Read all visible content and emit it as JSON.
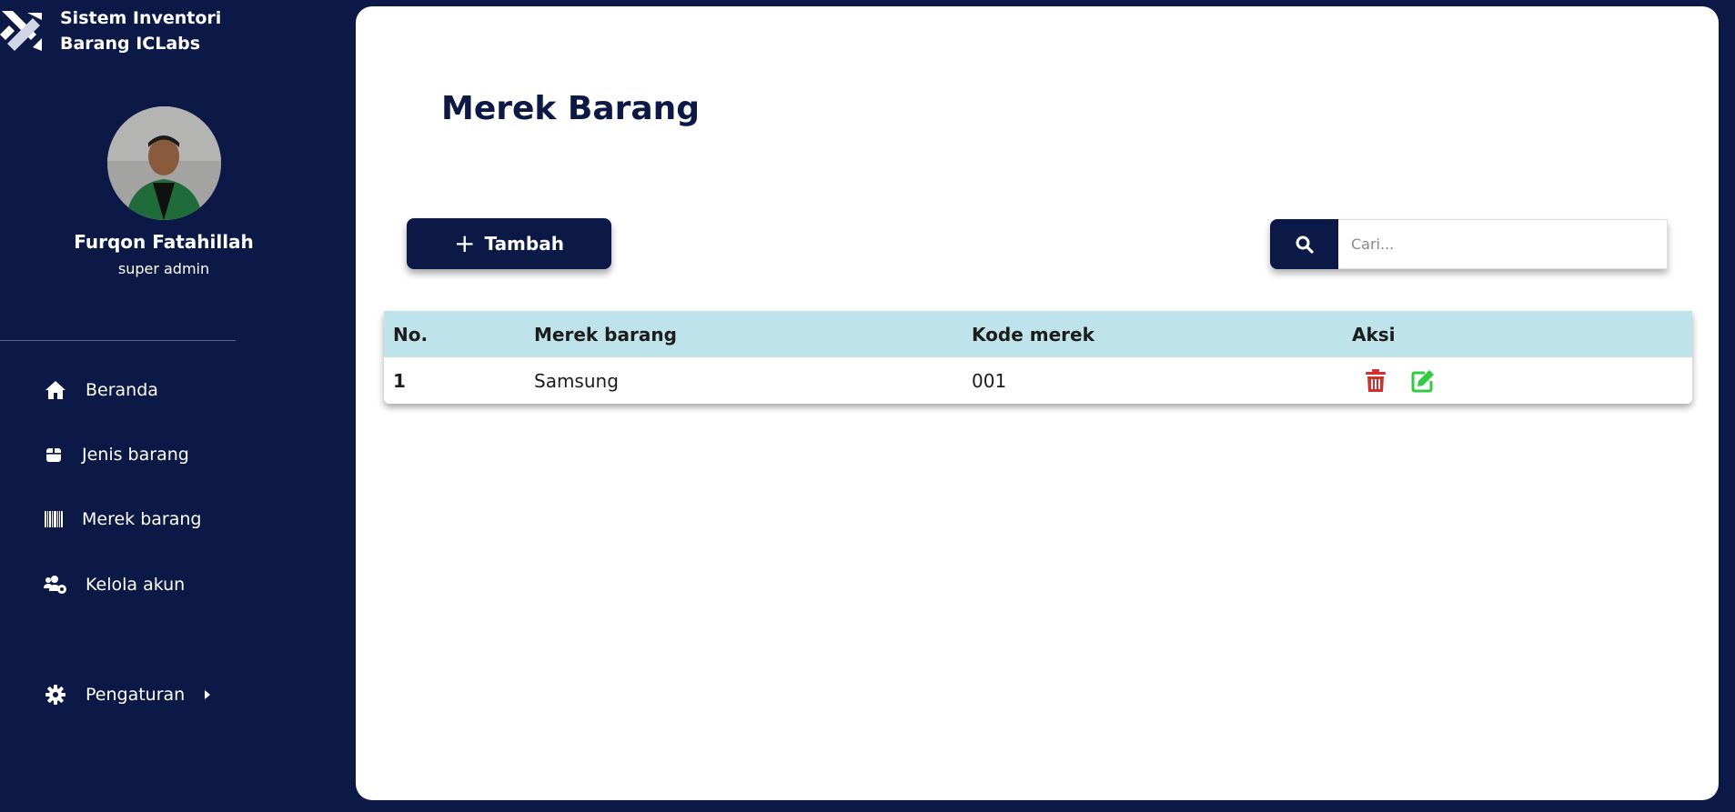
{
  "app": {
    "title": "Sistem Inventori Barang ICLabs"
  },
  "user": {
    "name": "Furqon Fatahillah",
    "role": "super admin"
  },
  "sidebar": {
    "items": [
      {
        "label": "Beranda",
        "icon": "home-icon"
      },
      {
        "label": "Jenis barang",
        "icon": "box-icon"
      },
      {
        "label": "Merek barang",
        "icon": "barcode-icon"
      },
      {
        "label": "Kelola akun",
        "icon": "users-cog-icon"
      }
    ],
    "settings": {
      "label": "Pengaturan",
      "icon": "gear-icon"
    }
  },
  "page": {
    "title": "Merek Barang",
    "add_label": "Tambah"
  },
  "search": {
    "placeholder": "Cari..."
  },
  "table": {
    "headers": [
      "No.",
      "Merek barang",
      "Kode merek",
      "Aksi"
    ],
    "rows": [
      {
        "no": "1",
        "name": "Samsung",
        "code": "001"
      }
    ]
  },
  "colors": {
    "navy": "#0c1846",
    "table_header": "#bee3ea",
    "delete": "#d32f2f",
    "edit": "#2ecc40"
  }
}
